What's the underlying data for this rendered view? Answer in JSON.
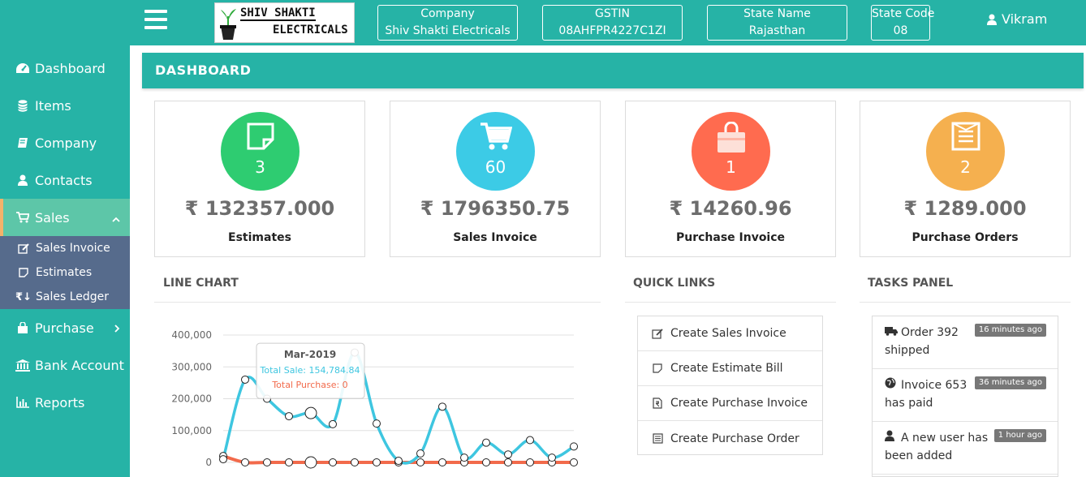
{
  "header": {
    "logo_line1": "SHIV SHAKTI",
    "logo_line2": "ELECTRICALS",
    "info": [
      {
        "label": "Company",
        "value": "Shiv Shakti Electricals"
      },
      {
        "label": "GSTIN",
        "value": "08AHFPR4227C1ZI"
      },
      {
        "label": "State Name",
        "value": "Rajasthan"
      },
      {
        "label": "State Code",
        "value": "08"
      }
    ],
    "user_name": "Vikram"
  },
  "sidebar": {
    "items": [
      {
        "label": "Dashboard",
        "icon": "dashboard-icon"
      },
      {
        "label": "Items",
        "icon": "database-icon"
      },
      {
        "label": "Company",
        "icon": "book-icon"
      },
      {
        "label": "Contacts",
        "icon": "user-icon"
      },
      {
        "label": "Sales",
        "icon": "cart-icon"
      },
      {
        "label": "Purchase",
        "icon": "shopping-bag-icon"
      },
      {
        "label": "Bank Account",
        "icon": "bank-icon"
      },
      {
        "label": "Reports",
        "icon": "bar-chart-icon"
      }
    ],
    "sales_submenu": [
      {
        "label": "Sales Invoice",
        "icon": "edit-icon"
      },
      {
        "label": "Estimates",
        "icon": "sticky-note-icon"
      },
      {
        "label": "Sales Ledger",
        "icon": "rupee-down-arrow-icon"
      }
    ],
    "active_item": "Sales"
  },
  "dashboard": {
    "title": "DASHBOARD",
    "cards": [
      {
        "count": "3",
        "amount": "₹ 132357.000",
        "label": "Estimates",
        "color": "#2ecc71",
        "icon": "sticky-note-icon"
      },
      {
        "count": "60",
        "amount": "₹ 1796350.75",
        "label": "Sales Invoice",
        "color": "#3ccbe6",
        "icon": "cart-icon"
      },
      {
        "count": "1",
        "amount": "₹ 14260.96",
        "label": "Purchase Invoice",
        "color": "#ff6b4f",
        "icon": "shopping-bag-icon"
      },
      {
        "count": "2",
        "amount": "₹ 1289.000",
        "label": "Purchase Orders",
        "color": "#f5b04f",
        "icon": "list-alt-icon"
      }
    ]
  },
  "sections": {
    "line_chart_title": "LINE CHART",
    "quick_links_title": "QUICK LINKS",
    "tasks_title": "TASKS PANEL"
  },
  "quick_links": [
    {
      "label": "Create Sales Invoice",
      "icon": "edit-icon"
    },
    {
      "label": "Create Estimate Bill",
      "icon": "sticky-note-icon"
    },
    {
      "label": "Create Purchase Invoice",
      "icon": "file-rupee-icon"
    },
    {
      "label": "Create Purchase Order",
      "icon": "list-alt-icon"
    }
  ],
  "tasks": [
    {
      "line1": "Order 392",
      "line2": "shipped",
      "badge": "16 minutes ago",
      "icon": "truck-icon"
    },
    {
      "line1": "Invoice 653",
      "line2": "has paid",
      "badge": "36 minutes ago",
      "icon": "globe-icon"
    },
    {
      "line1": "A new user has",
      "line2": "been added",
      "badge": "1 hour ago",
      "icon": "user-icon"
    }
  ],
  "chart_data": {
    "type": "line",
    "ylim": [
      0,
      400000
    ],
    "yticks": [
      "400,000",
      "300,000",
      "200,000",
      "100,000",
      "0"
    ],
    "series": [
      {
        "name": "Total Sale",
        "color": "#3ec6e0",
        "values": [
          10000,
          260000,
          200000,
          145000,
          155000,
          120000,
          345000,
          122000,
          5000,
          28000,
          175000,
          15000,
          62000,
          25000,
          70000,
          15000,
          50000
        ]
      },
      {
        "name": "Total Purchase",
        "color": "#f26a4b",
        "values": [
          20000,
          0,
          0,
          0,
          0,
          0,
          0,
          0,
          0,
          0,
          0,
          0,
          0,
          0,
          0,
          0,
          0
        ]
      }
    ],
    "tooltip": {
      "title": "Mar-2019",
      "sale_text": "Total Sale: 154,784.84",
      "purchase_text": "Total Purchase: 0"
    }
  }
}
